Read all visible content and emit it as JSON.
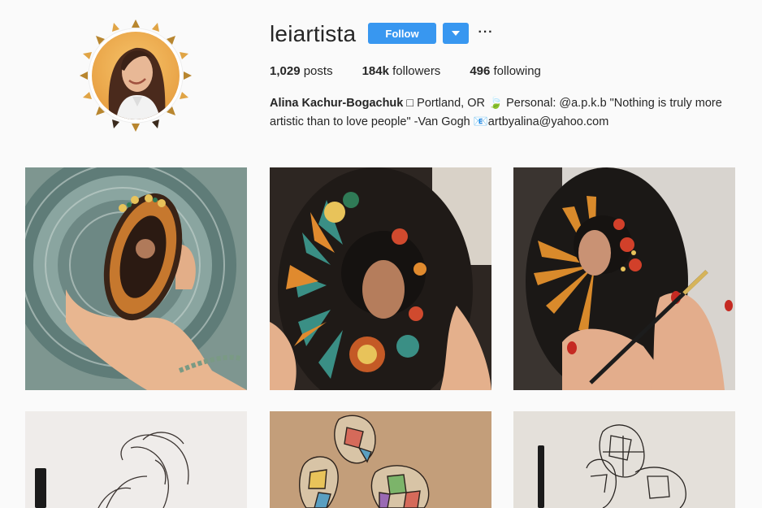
{
  "profile": {
    "username": "leiartista",
    "follow_label": "Follow",
    "more_label": "···",
    "stats": {
      "posts_count": "1,029",
      "posts_label": "posts",
      "followers_count": "184k",
      "followers_label": "followers",
      "following_count": "496",
      "following_label": "following"
    },
    "bio": {
      "name": "Alina Kachur-Bogachuk",
      "line1_rest": " □ Portland, OR 🍃 Personal: @a.p.k.b \"Nothing is truly more",
      "line2": "artistic than to love people\" -Van Gogh 📧artbyalina@yahoo.com"
    }
  },
  "colors": {
    "accent": "#3897f0",
    "background": "#fafafa",
    "text": "#262626"
  },
  "posts": [
    {
      "subject": "hand holding painted oval art with mandala background"
    },
    {
      "subject": "painted oval portrait with floral sunburst"
    },
    {
      "subject": "painting a black oval portrait with brush"
    },
    {
      "subject": "ink sketch of embracing figures with pen"
    },
    {
      "subject": "geometric colored line drawing of faces on kraft paper"
    },
    {
      "subject": "geometric ink drawing of faces with pen"
    }
  ]
}
